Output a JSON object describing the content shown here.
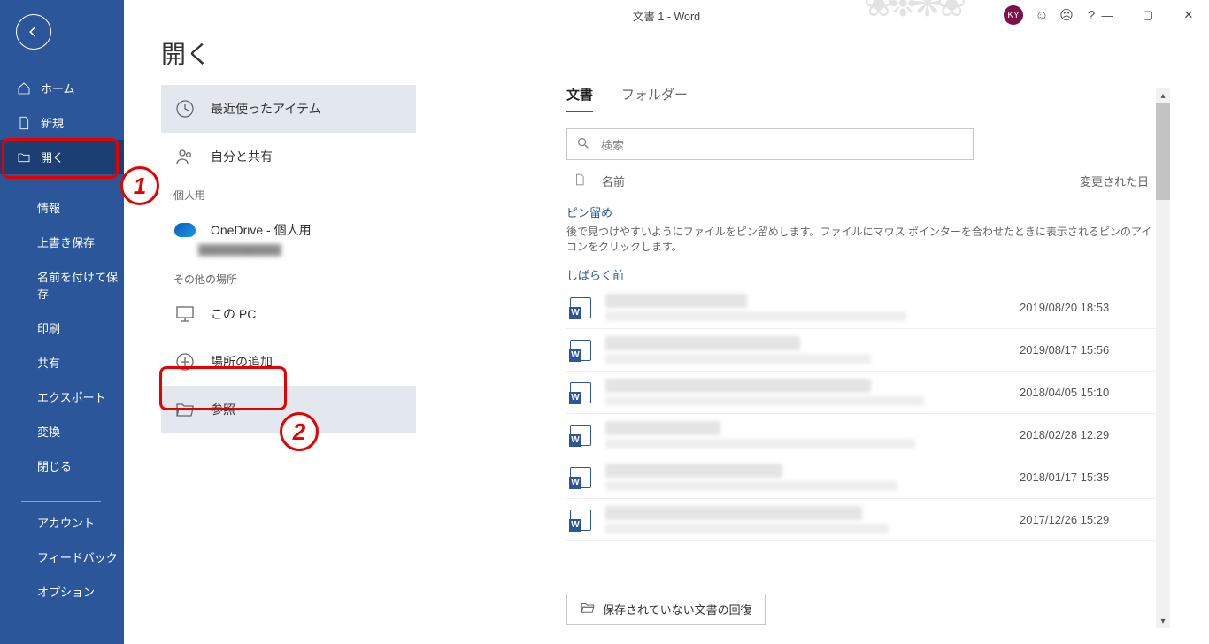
{
  "titlebar": {
    "doc_title": "文書 1  -  Word"
  },
  "account": {
    "initials": "KY"
  },
  "sidebar": {
    "home": "ホーム",
    "new": "新規",
    "open": "開く",
    "info": "情報",
    "overwrite_save": "上書き保存",
    "save_as": "名前を付けて保存",
    "print": "印刷",
    "share": "共有",
    "export": "エクスポート",
    "convert": "変換",
    "close": "閉じる",
    "account": "アカウント",
    "feedback": "フィードバック",
    "options": "オプション"
  },
  "page": {
    "title": "開く"
  },
  "locations": {
    "recent": "最近使ったアイテム",
    "shared": "自分と共有",
    "personal_label": "個人用",
    "onedrive": "OneDrive - 個人用",
    "other_label": "その他の場所",
    "this_pc": "この PC",
    "add_place": "場所の追加",
    "browse": "参照"
  },
  "content": {
    "tab_docs": "文書",
    "tab_folders": "フォルダー",
    "search_ph": "検索",
    "name_hdr": "名前",
    "modified_hdr": "変更された日",
    "pin_hdr": "ピン留め",
    "pin_hint": "後で見つけやすいようにファイルをピン留めします。ファイルにマウス ポインターを合わせたときに表示されるピンのアイコンをクリックします。",
    "group_recent": "しばらく前",
    "files": [
      {
        "date": "2019/08/20 18:53",
        "w1": 160,
        "w2": 340
      },
      {
        "date": "2019/08/17 15:56",
        "w1": 220,
        "w2": 300
      },
      {
        "date": "2018/04/05 15:10",
        "w1": 300,
        "w2": 360
      },
      {
        "date": "2018/02/28 12:29",
        "w1": 130,
        "w2": 350
      },
      {
        "date": "2018/01/17 15:35",
        "w1": 200,
        "w2": 330
      },
      {
        "date": "2017/12/26 15:29",
        "w1": 290,
        "w2": 320
      }
    ],
    "recover": "保存されていない文書の回復"
  },
  "annotations": {
    "n1": "1",
    "n2": "2"
  }
}
